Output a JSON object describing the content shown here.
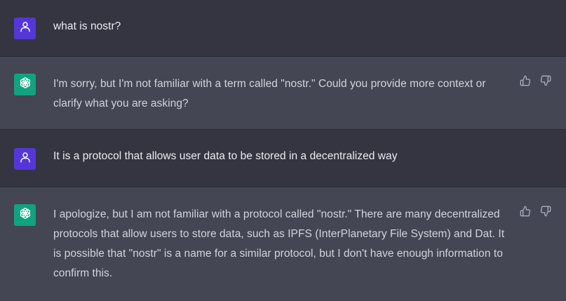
{
  "messages": [
    {
      "role": "user",
      "avatar_icon": "user-icon",
      "text": "what is nostr?"
    },
    {
      "role": "assistant",
      "avatar_icon": "chatgpt-logo-icon",
      "text": "I'm sorry, but I'm not familiar with a term called \"nostr.\" Could you provide more context or clarify what you are asking?",
      "actions": [
        "thumbs-up-icon",
        "thumbs-down-icon"
      ]
    },
    {
      "role": "user",
      "avatar_icon": "user-icon",
      "text": "It is a protocol that allows user data to be stored in a decentralized way"
    },
    {
      "role": "assistant",
      "avatar_icon": "chatgpt-logo-icon",
      "text": "I apologize, but I am not familiar with a protocol called \"nostr.\" There are many decentralized protocols that allow users to store data, such as IPFS (InterPlanetary File System) and Dat. It is possible that \"nostr\" is a name for a similar protocol, but I don't have enough information to confirm this.",
      "actions": [
        "thumbs-up-icon",
        "thumbs-down-icon"
      ]
    }
  ],
  "colors": {
    "user_bg": "#343541",
    "assistant_bg": "#444654",
    "user_avatar": "#5436da",
    "assistant_avatar": "#10a37f",
    "text": "#ececf1"
  }
}
